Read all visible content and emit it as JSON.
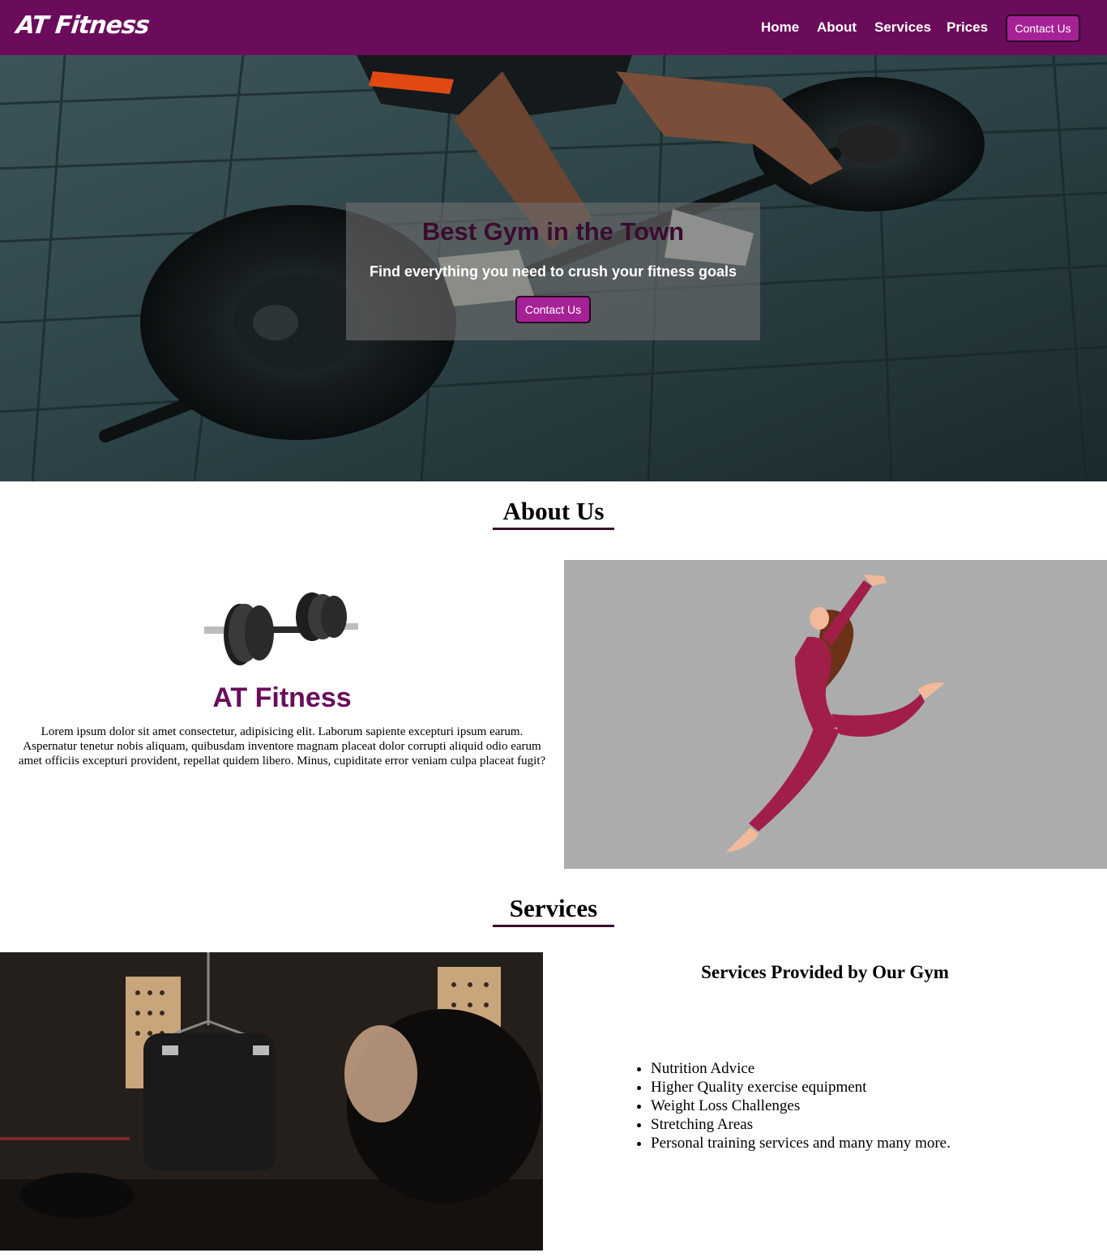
{
  "nav": {
    "brand": "AT Fitness",
    "links": [
      "Home",
      "About",
      "Services",
      "Prices"
    ],
    "contact_label": "Contact Us"
  },
  "hero": {
    "title": "Best Gym in the Town",
    "subtitle": "Find everything you need to crush your fitness goals",
    "button_label": "Contact Us"
  },
  "about": {
    "heading": "About Us",
    "brand": "AT Fitness",
    "text": "Lorem ipsum dolor sit amet consectetur, adipisicing elit. Laborum sapiente excepturi ipsum earum. Aspernatur tenetur nobis aliquam, quibusdam inventore magnam placeat dolor corrupti aliquid odio earum amet officiis excepturi provident, repellat quidem libero. Minus, cupiditate error veniam culpa placeat fugit?"
  },
  "services": {
    "heading": "Services",
    "subheading": "Services Provided by Our Gym",
    "items": [
      "Nutrition Advice",
      "Higher Quality exercise equipment",
      "Weight Loss Challenges",
      "Stretching Areas",
      "Personal training services and many many more."
    ]
  },
  "colors": {
    "brand_purple": "#6a0c5b",
    "button_magenta": "#a62195"
  }
}
